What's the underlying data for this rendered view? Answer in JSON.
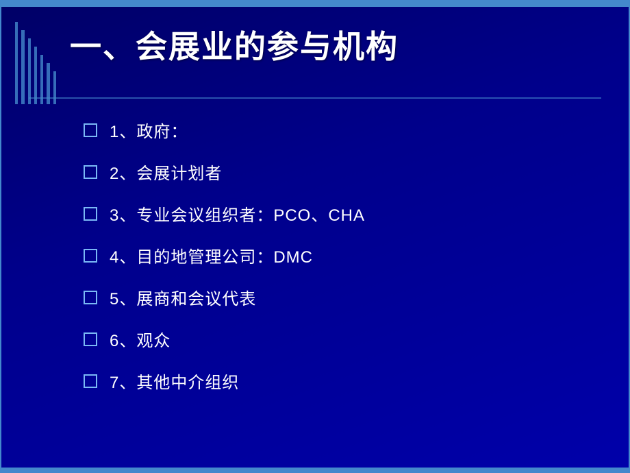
{
  "slide": {
    "colors": {
      "background": "#00008B",
      "accent": "#4488cc",
      "text": "#ffffff"
    },
    "title": "一、会展业的参与机构",
    "items": [
      {
        "id": 1,
        "text": "1、政府："
      },
      {
        "id": 2,
        "text": "2、会展计划者"
      },
      {
        "id": 3,
        "text": "3、专业会议组织者：PCO、CHA"
      },
      {
        "id": 4,
        "text": "4、目的地管理公司：DMC"
      },
      {
        "id": 5,
        "text": "5、展商和会议代表"
      },
      {
        "id": 6,
        "text": "6、观众"
      },
      {
        "id": 7,
        "text": "7、其他中介组织"
      }
    ]
  }
}
